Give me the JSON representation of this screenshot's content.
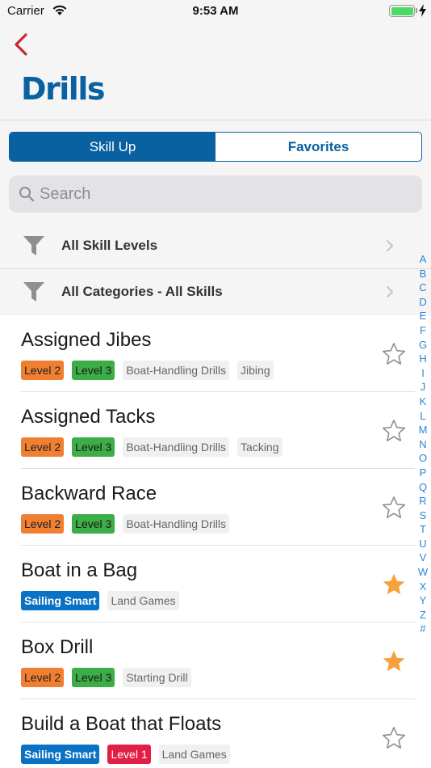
{
  "status_bar": {
    "carrier": "Carrier",
    "time": "9:53 AM"
  },
  "header": {
    "title": "Drills"
  },
  "segments": [
    {
      "label": "Skill Up",
      "active": true
    },
    {
      "label": "Favorites",
      "active": false
    }
  ],
  "search": {
    "placeholder": "Search",
    "value": ""
  },
  "filters": [
    {
      "label": "All Skill Levels"
    },
    {
      "label": "All Categories - All Skills"
    }
  ],
  "index": [
    "A",
    "B",
    "C",
    "D",
    "E",
    "F",
    "G",
    "H",
    "I",
    "J",
    "K",
    "L",
    "M",
    "N",
    "O",
    "P",
    "Q",
    "R",
    "S",
    "T",
    "U",
    "V",
    "W",
    "X",
    "Y",
    "Z",
    "#"
  ],
  "colors": {
    "brand_blue": "#0a61a1",
    "level_1": "#e11e44",
    "level_2": "#f07f31",
    "level_3": "#3dad48",
    "sailing_smart": "#0a72c4",
    "star_on": "#f7a13a",
    "index": "#2a86d6"
  },
  "drills": [
    {
      "name": "Assigned Jibes",
      "favorite": false,
      "tags": [
        {
          "label": "Level 2",
          "kind": "l2"
        },
        {
          "label": "Level 3",
          "kind": "l3"
        },
        {
          "label": "Boat-Handling Drills",
          "kind": "plain"
        },
        {
          "label": "Jibing",
          "kind": "plain"
        }
      ]
    },
    {
      "name": "Assigned Tacks",
      "favorite": false,
      "tags": [
        {
          "label": "Level 2",
          "kind": "l2"
        },
        {
          "label": "Level 3",
          "kind": "l3"
        },
        {
          "label": "Boat-Handling Drills",
          "kind": "plain"
        },
        {
          "label": "Tacking",
          "kind": "plain"
        }
      ]
    },
    {
      "name": "Backward Race",
      "favorite": false,
      "tags": [
        {
          "label": "Level 2",
          "kind": "l2"
        },
        {
          "label": "Level 3",
          "kind": "l3"
        },
        {
          "label": "Boat-Handling Drills",
          "kind": "plain"
        }
      ]
    },
    {
      "name": "Boat in a Bag",
      "favorite": true,
      "tags": [
        {
          "label": "Sailing Smart",
          "kind": "ss"
        },
        {
          "label": "Land Games",
          "kind": "plain"
        }
      ]
    },
    {
      "name": "Box Drill",
      "favorite": true,
      "tags": [
        {
          "label": "Level 2",
          "kind": "l2"
        },
        {
          "label": "Level 3",
          "kind": "l3"
        },
        {
          "label": "Starting Drill",
          "kind": "plain"
        }
      ]
    },
    {
      "name": "Build a Boat that Floats",
      "favorite": false,
      "tags": [
        {
          "label": "Sailing Smart",
          "kind": "ss"
        },
        {
          "label": "Level 1",
          "kind": "l1"
        },
        {
          "label": "Land Games",
          "kind": "plain"
        }
      ]
    }
  ]
}
